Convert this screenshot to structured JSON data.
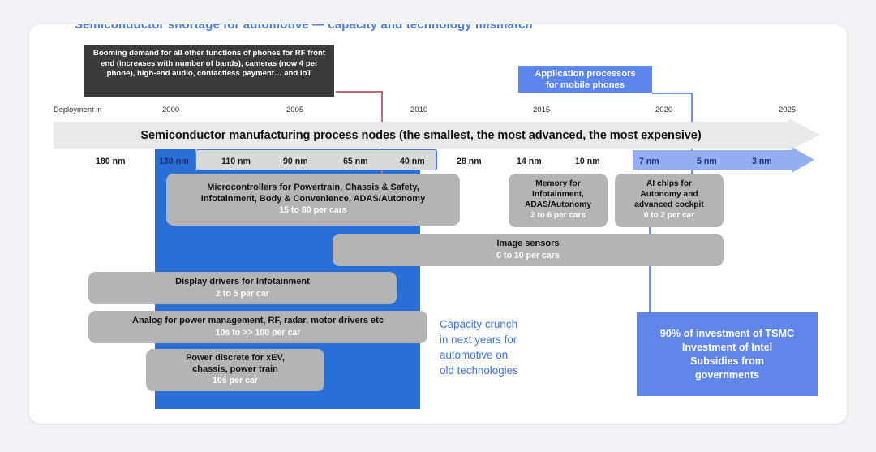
{
  "slide": {
    "title_remnant": "Semiconductor shortage for automotive — capacity and technology mismatch",
    "banner_text": "Semiconductor manufacturing process nodes (the smallest, the most advanced, the most expensive)"
  },
  "callouts": {
    "phones": "Booming demand for all other functions of phones for RF front end (increases with number of bands), cameras (now 4 per phone), high-end audio, contactless payment… and IoT",
    "app_processors": "Application processors\nfor mobile phones",
    "app_processors_line1": "Application processors",
    "app_processors_line2": "for mobile phones"
  },
  "axis": {
    "lead_label": "Deployment in",
    "ticks": [
      "2000",
      "2005",
      "2010",
      "2015",
      "2020",
      "2025"
    ]
  },
  "nodes": [
    {
      "label": "180 nm",
      "style": "plain"
    },
    {
      "label": "130 nm",
      "style": "blue-fill"
    },
    {
      "label": "110 nm",
      "style": "boxed"
    },
    {
      "label": "90 nm",
      "style": "boxed"
    },
    {
      "label": "65 nm",
      "style": "boxed"
    },
    {
      "label": "40 nm",
      "style": "boxed"
    },
    {
      "label": "28 nm",
      "style": "plain"
    },
    {
      "label": "14 nm",
      "style": "plain"
    },
    {
      "label": "10 nm",
      "style": "plain"
    },
    {
      "label": "7 nm",
      "style": "advanced"
    },
    {
      "label": "5 nm",
      "style": "advanced"
    },
    {
      "label": "3 nm",
      "style": "advanced"
    }
  ],
  "segments": [
    {
      "name": "microcontrollers",
      "title_line1": "Microcontrollers for Powertrain, Chassis & Safety,",
      "title_line2": "Infotainment, Body & Convenience, ADAS/Autonomy",
      "qty": "15 to 80 per cars"
    },
    {
      "name": "memory",
      "title_line1": "Memory for",
      "title_line2": "Infotainment,",
      "title_line3": "ADAS/Autonomy",
      "qty": "2 to 6 per cars"
    },
    {
      "name": "ai-chips",
      "title_line1": "AI chips for",
      "title_line2": "Autonomy and",
      "title_line3": "advanced cockpit",
      "qty": "0 to 2 per car"
    },
    {
      "name": "image-sensors",
      "title_line1": "Image sensors",
      "qty": "0 to 10 per cars"
    },
    {
      "name": "display-drivers",
      "title_line1": "Display drivers for Infotainment",
      "qty": "2 to 5 per car"
    },
    {
      "name": "analog",
      "title_line1": "Analog for power management, RF, radar, motor drivers etc",
      "qty": "10s to >> 100 per car"
    },
    {
      "name": "power-discrete",
      "title_line1": "Power discrete for xEV,",
      "title_line2": "chassis, power train",
      "qty": "10s per car"
    }
  ],
  "notes": {
    "capacity_crunch_l1": "Capacity crunch",
    "capacity_crunch_l2": "in next years for",
    "capacity_crunch_l3": "automotive on",
    "capacity_crunch_l4": "old technologies",
    "investment_l1": "90% of investment of TSMC",
    "investment_l2": "Investment of Intel",
    "investment_l3": "Subsidies from",
    "investment_l4": "governments"
  },
  "colors": {
    "blue_band": "#2a6fd6",
    "light_blue": "#93aff1",
    "panel_blue": "#6186ea",
    "gray_box": "#b4b4b4",
    "banner_gray": "#e9e9e9",
    "dark_callout": "#3b3b3b",
    "note_blue": "#3f73dd"
  }
}
